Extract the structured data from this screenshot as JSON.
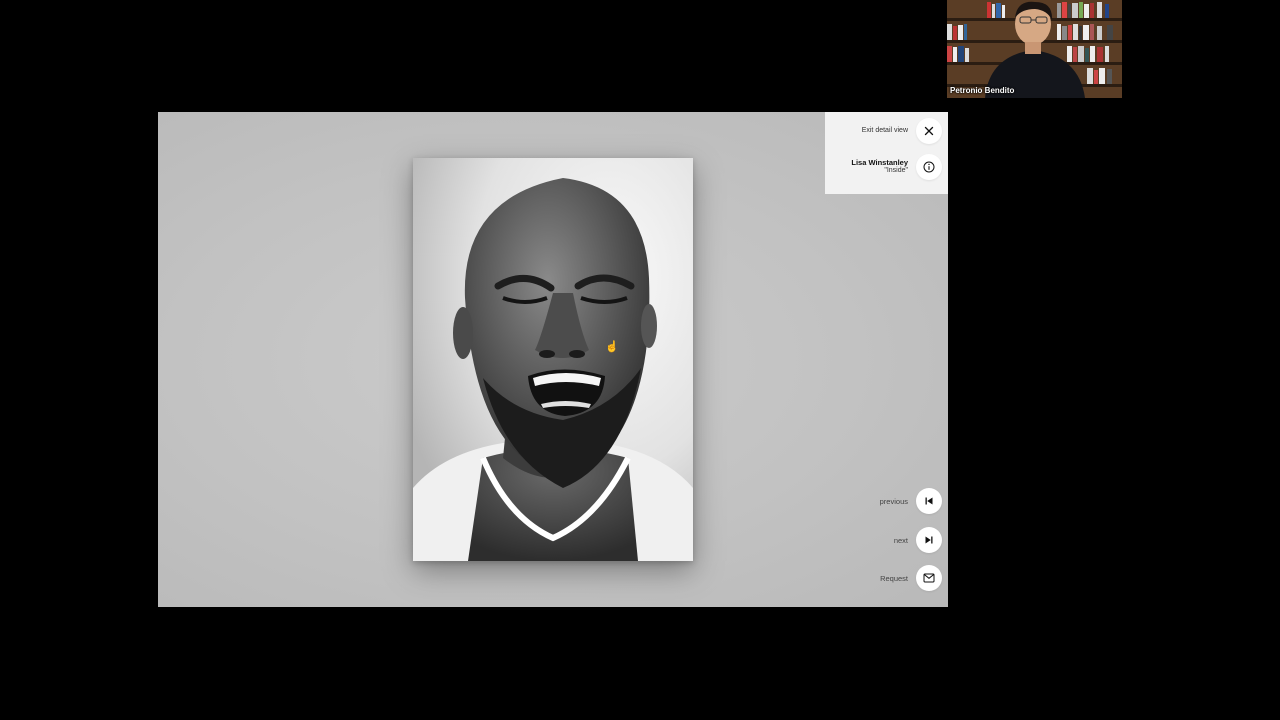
{
  "participant": {
    "name": "Petronio Bendito"
  },
  "viewer": {
    "exit_label": "Exit detail view",
    "artist": "Lisa Winstanley",
    "artwork_title": "\"Inside\"",
    "previous_label": "previous",
    "next_label": "next",
    "request_label": "Request"
  },
  "icons": {
    "close": "close-icon",
    "info": "info-icon",
    "previous": "skip-previous-icon",
    "next": "skip-next-icon",
    "request": "mail-icon"
  },
  "colors": {
    "background": "#000000",
    "screen_bg": "#c4c4c4",
    "panel_bg": "#f2f2f2",
    "button_bg": "#ffffff"
  }
}
